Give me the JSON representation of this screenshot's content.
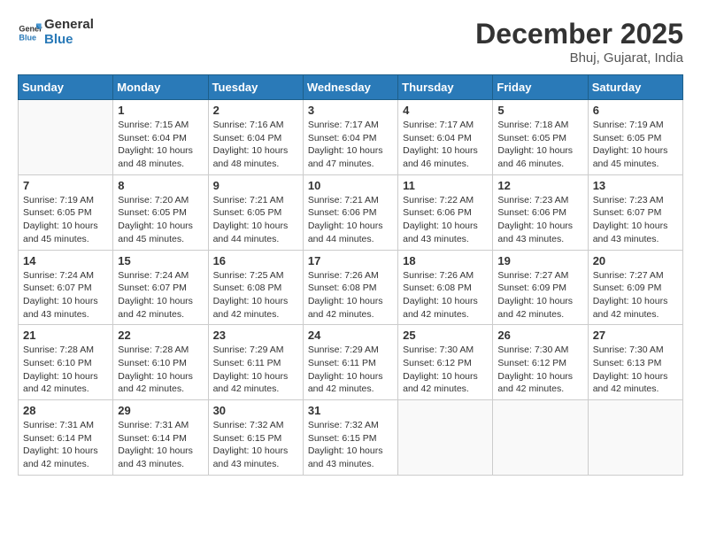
{
  "header": {
    "logo_line1": "General",
    "logo_line2": "Blue",
    "month_title": "December 2025",
    "location": "Bhuj, Gujarat, India"
  },
  "calendar": {
    "days_of_week": [
      "Sunday",
      "Monday",
      "Tuesday",
      "Wednesday",
      "Thursday",
      "Friday",
      "Saturday"
    ],
    "weeks": [
      [
        {
          "day": "",
          "info": ""
        },
        {
          "day": "1",
          "info": "Sunrise: 7:15 AM\nSunset: 6:04 PM\nDaylight: 10 hours\nand 48 minutes."
        },
        {
          "day": "2",
          "info": "Sunrise: 7:16 AM\nSunset: 6:04 PM\nDaylight: 10 hours\nand 48 minutes."
        },
        {
          "day": "3",
          "info": "Sunrise: 7:17 AM\nSunset: 6:04 PM\nDaylight: 10 hours\nand 47 minutes."
        },
        {
          "day": "4",
          "info": "Sunrise: 7:17 AM\nSunset: 6:04 PM\nDaylight: 10 hours\nand 46 minutes."
        },
        {
          "day": "5",
          "info": "Sunrise: 7:18 AM\nSunset: 6:05 PM\nDaylight: 10 hours\nand 46 minutes."
        },
        {
          "day": "6",
          "info": "Sunrise: 7:19 AM\nSunset: 6:05 PM\nDaylight: 10 hours\nand 45 minutes."
        }
      ],
      [
        {
          "day": "7",
          "info": "Sunrise: 7:19 AM\nSunset: 6:05 PM\nDaylight: 10 hours\nand 45 minutes."
        },
        {
          "day": "8",
          "info": "Sunrise: 7:20 AM\nSunset: 6:05 PM\nDaylight: 10 hours\nand 45 minutes."
        },
        {
          "day": "9",
          "info": "Sunrise: 7:21 AM\nSunset: 6:05 PM\nDaylight: 10 hours\nand 44 minutes."
        },
        {
          "day": "10",
          "info": "Sunrise: 7:21 AM\nSunset: 6:06 PM\nDaylight: 10 hours\nand 44 minutes."
        },
        {
          "day": "11",
          "info": "Sunrise: 7:22 AM\nSunset: 6:06 PM\nDaylight: 10 hours\nand 43 minutes."
        },
        {
          "day": "12",
          "info": "Sunrise: 7:23 AM\nSunset: 6:06 PM\nDaylight: 10 hours\nand 43 minutes."
        },
        {
          "day": "13",
          "info": "Sunrise: 7:23 AM\nSunset: 6:07 PM\nDaylight: 10 hours\nand 43 minutes."
        }
      ],
      [
        {
          "day": "14",
          "info": "Sunrise: 7:24 AM\nSunset: 6:07 PM\nDaylight: 10 hours\nand 43 minutes."
        },
        {
          "day": "15",
          "info": "Sunrise: 7:24 AM\nSunset: 6:07 PM\nDaylight: 10 hours\nand 42 minutes."
        },
        {
          "day": "16",
          "info": "Sunrise: 7:25 AM\nSunset: 6:08 PM\nDaylight: 10 hours\nand 42 minutes."
        },
        {
          "day": "17",
          "info": "Sunrise: 7:26 AM\nSunset: 6:08 PM\nDaylight: 10 hours\nand 42 minutes."
        },
        {
          "day": "18",
          "info": "Sunrise: 7:26 AM\nSunset: 6:08 PM\nDaylight: 10 hours\nand 42 minutes."
        },
        {
          "day": "19",
          "info": "Sunrise: 7:27 AM\nSunset: 6:09 PM\nDaylight: 10 hours\nand 42 minutes."
        },
        {
          "day": "20",
          "info": "Sunrise: 7:27 AM\nSunset: 6:09 PM\nDaylight: 10 hours\nand 42 minutes."
        }
      ],
      [
        {
          "day": "21",
          "info": "Sunrise: 7:28 AM\nSunset: 6:10 PM\nDaylight: 10 hours\nand 42 minutes."
        },
        {
          "day": "22",
          "info": "Sunrise: 7:28 AM\nSunset: 6:10 PM\nDaylight: 10 hours\nand 42 minutes."
        },
        {
          "day": "23",
          "info": "Sunrise: 7:29 AM\nSunset: 6:11 PM\nDaylight: 10 hours\nand 42 minutes."
        },
        {
          "day": "24",
          "info": "Sunrise: 7:29 AM\nSunset: 6:11 PM\nDaylight: 10 hours\nand 42 minutes."
        },
        {
          "day": "25",
          "info": "Sunrise: 7:30 AM\nSunset: 6:12 PM\nDaylight: 10 hours\nand 42 minutes."
        },
        {
          "day": "26",
          "info": "Sunrise: 7:30 AM\nSunset: 6:12 PM\nDaylight: 10 hours\nand 42 minutes."
        },
        {
          "day": "27",
          "info": "Sunrise: 7:30 AM\nSunset: 6:13 PM\nDaylight: 10 hours\nand 42 minutes."
        }
      ],
      [
        {
          "day": "28",
          "info": "Sunrise: 7:31 AM\nSunset: 6:14 PM\nDaylight: 10 hours\nand 42 minutes."
        },
        {
          "day": "29",
          "info": "Sunrise: 7:31 AM\nSunset: 6:14 PM\nDaylight: 10 hours\nand 43 minutes."
        },
        {
          "day": "30",
          "info": "Sunrise: 7:32 AM\nSunset: 6:15 PM\nDaylight: 10 hours\nand 43 minutes."
        },
        {
          "day": "31",
          "info": "Sunrise: 7:32 AM\nSunset: 6:15 PM\nDaylight: 10 hours\nand 43 minutes."
        },
        {
          "day": "",
          "info": ""
        },
        {
          "day": "",
          "info": ""
        },
        {
          "day": "",
          "info": ""
        }
      ]
    ]
  }
}
